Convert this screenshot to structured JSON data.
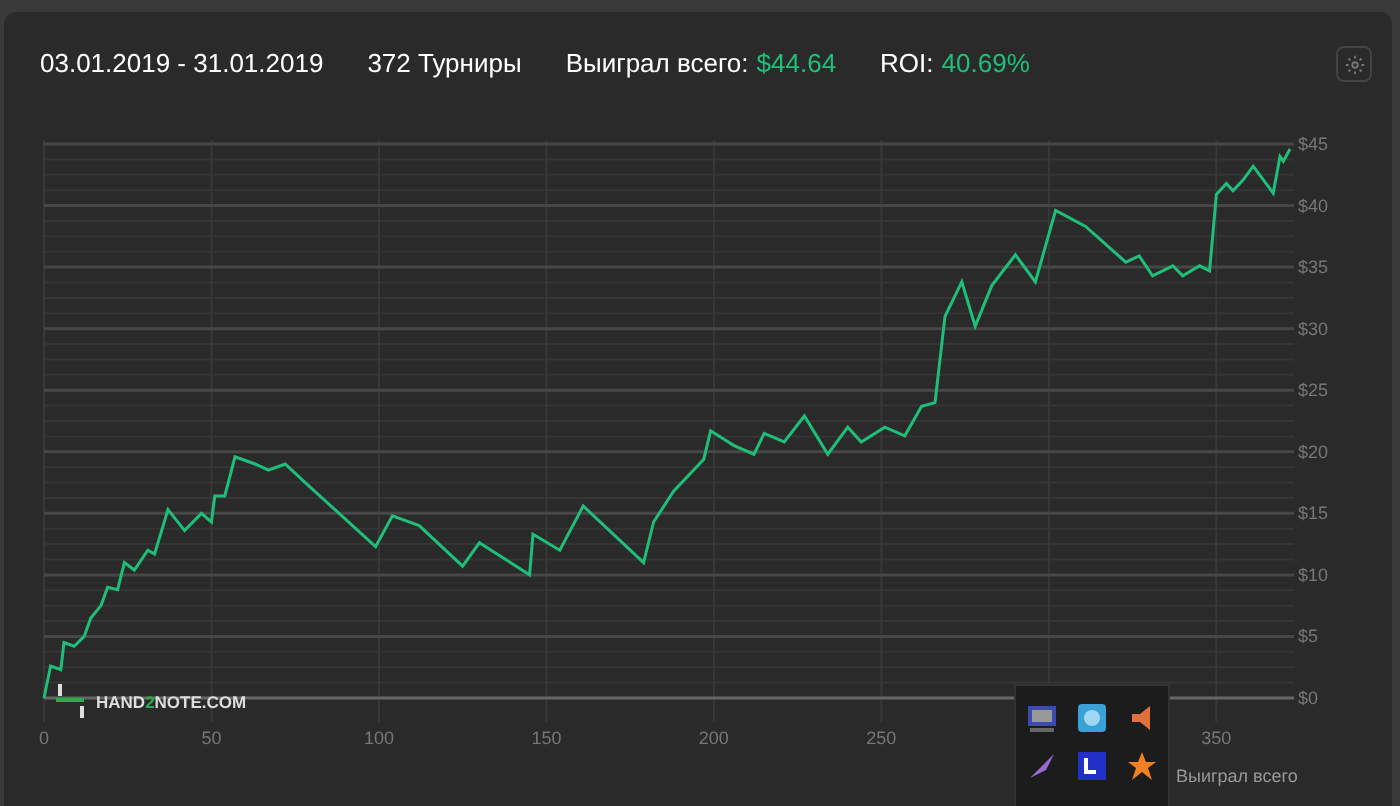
{
  "header": {
    "date_range": "03.01.2019 - 31.01.2019",
    "tournaments": "372 Турниры",
    "won_label": "Выиграл всего:",
    "won_value": "$44.64",
    "roi_label": "ROI:",
    "roi_value": "40.69%"
  },
  "chart": {
    "logo": [
      {
        "text": "HAND",
        "accent": false
      },
      {
        "text": "2",
        "accent": true
      },
      {
        "text": "NOTE.COM",
        "accent": false
      }
    ],
    "chart_data": {
      "type": "line",
      "xlim": [
        0,
        372
      ],
      "ylim": [
        0,
        45
      ],
      "grid": true,
      "xticks": [
        0,
        50,
        100,
        150,
        200,
        250,
        350
      ],
      "yticks": [
        {
          "value": 0,
          "label": "$0"
        },
        {
          "value": 5,
          "label": "$5"
        },
        {
          "value": 10,
          "label": "$10"
        },
        {
          "value": 15,
          "label": "$15"
        },
        {
          "value": 20,
          "label": "$20"
        },
        {
          "value": 25,
          "label": "$25"
        },
        {
          "value": 30,
          "label": "$30"
        },
        {
          "value": 35,
          "label": "$35"
        },
        {
          "value": 40,
          "label": "$40"
        },
        {
          "value": 45,
          "label": "$45"
        }
      ],
      "x": [
        0,
        2,
        5,
        6,
        9,
        12,
        14,
        17,
        19,
        22,
        24,
        27,
        31,
        33,
        37,
        42,
        47,
        50,
        51,
        54,
        57,
        63,
        67,
        72,
        78,
        99,
        104,
        112,
        125,
        130,
        145,
        146,
        154,
        161,
        179,
        182,
        188,
        197,
        199,
        206,
        212,
        215,
        221,
        227,
        234,
        240,
        244,
        251,
        257,
        262,
        266,
        269,
        274,
        278,
        283,
        290,
        296,
        302,
        311,
        323,
        327,
        331,
        337,
        340,
        345,
        348,
        350,
        353,
        355,
        358,
        361,
        367,
        369,
        370,
        372
      ],
      "series": [
        {
          "name": "Выиграл всего",
          "color": "#1fbf7a",
          "values": [
            0,
            2.6,
            2.3,
            4.5,
            4.2,
            5,
            6.5,
            7.5,
            9,
            8.8,
            11,
            10.4,
            12,
            11.7,
            15.3,
            13.6,
            15,
            14.3,
            16.4,
            16.4,
            19.6,
            19,
            18.5,
            19,
            17.5,
            12.3,
            14.8,
            14,
            10.7,
            12.6,
            10,
            13.3,
            12,
            15.6,
            11,
            14.3,
            16.8,
            19.4,
            21.7,
            20.5,
            19.8,
            21.5,
            20.8,
            22.9,
            19.8,
            22,
            20.8,
            22,
            21.3,
            23.7,
            24,
            31,
            33.8,
            30.2,
            33.5,
            36,
            33.8,
            39.6,
            38.3,
            35.4,
            35.9,
            34.3,
            35.1,
            34.3,
            35.1,
            34.7,
            40.9,
            41.8,
            41.2,
            42.1,
            43.2,
            41,
            44,
            43.6,
            44.6
          ]
        }
      ]
    }
  }
}
